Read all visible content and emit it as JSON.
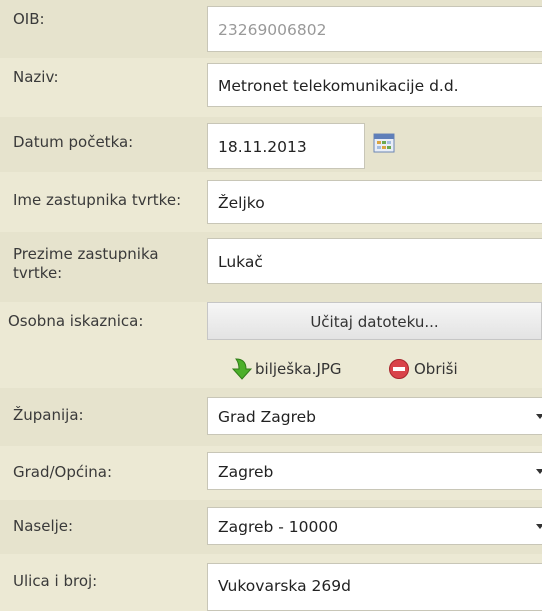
{
  "form": {
    "oib": {
      "label": "OIB:",
      "value": "23269006802"
    },
    "naziv": {
      "label": "Naziv:",
      "value": "Metronet telekomunikacije d.d."
    },
    "datum": {
      "label": "Datum početka:",
      "value": "18.11.2013",
      "icon": "calendar-icon"
    },
    "ime": {
      "label": "Ime zastupnika tvrtke:",
      "value": "Željko"
    },
    "prezime": {
      "label_line1": "Prezime zastupnika",
      "label_line2": "tvrtke:",
      "value": "Lukač"
    },
    "osobna": {
      "label": "Osobna iskaznica:",
      "button_label": "Učitaj datoteku...",
      "file_name": "bilješka.JPG",
      "file_icon": "download-arrow-icon",
      "delete_label": "Obriši",
      "delete_icon": "delete-minus-icon"
    },
    "zupanija": {
      "label": "Županija:",
      "value": "Grad Zagreb"
    },
    "grad": {
      "label": "Grad/Općina:",
      "value": "Zagreb"
    },
    "naselje": {
      "label": "Naselje:",
      "value": "Zagreb - 10000"
    },
    "ulica": {
      "label": "Ulica i broj:",
      "value": "Vukovarska 269d"
    }
  },
  "colors": {
    "background": "#ece9d4",
    "row_shade": "#e6e3cd",
    "field_border": "#c8c6b7",
    "delete_red": "#d9434a",
    "arrow_green": "#4caf2a"
  }
}
